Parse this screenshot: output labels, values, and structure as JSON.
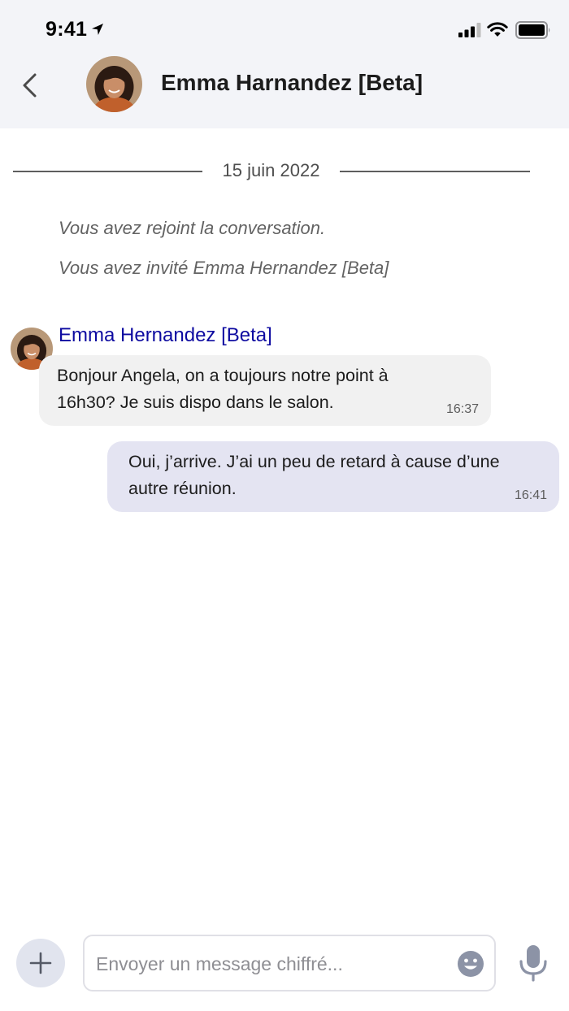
{
  "status_bar": {
    "time": "9:41",
    "icons": [
      "location-arrow-icon",
      "cellular-signal-icon",
      "wifi-icon",
      "battery-icon"
    ]
  },
  "header": {
    "contact_name": "Emma Harnandez [Beta]",
    "icons": [
      "chevron-left-icon",
      "avatar-photo"
    ]
  },
  "conversation": {
    "date_separator": "15 juin 2022",
    "system_messages": [
      "Vous avez rejoint la conversation.",
      "Vous avez invité Emma Hernandez [Beta]"
    ],
    "messages": [
      {
        "direction": "incoming",
        "sender": "Emma Hernandez [Beta]",
        "text": "Bonjour Angela, on a toujours notre point à 16h30? Je suis dispo dans le salon.",
        "time": "16:37"
      },
      {
        "direction": "outgoing",
        "text": "Oui, j’arrive. J’ai un peu de retard à cause d’une autre réunion.",
        "time": "16:41"
      }
    ]
  },
  "composer": {
    "placeholder": "Envoyer un message chiffré...",
    "value": "",
    "icons": [
      "plus-icon",
      "emoji-icon",
      "microphone-icon"
    ]
  },
  "colors": {
    "header_background": "#f3f4f8",
    "sender_name": "#0d0aa0",
    "incoming_bubble": "#f1f1f1",
    "outgoing_bubble": "#e4e4f2",
    "add_button": "#e1e4ee",
    "icon_gray": "#8c93a6"
  }
}
